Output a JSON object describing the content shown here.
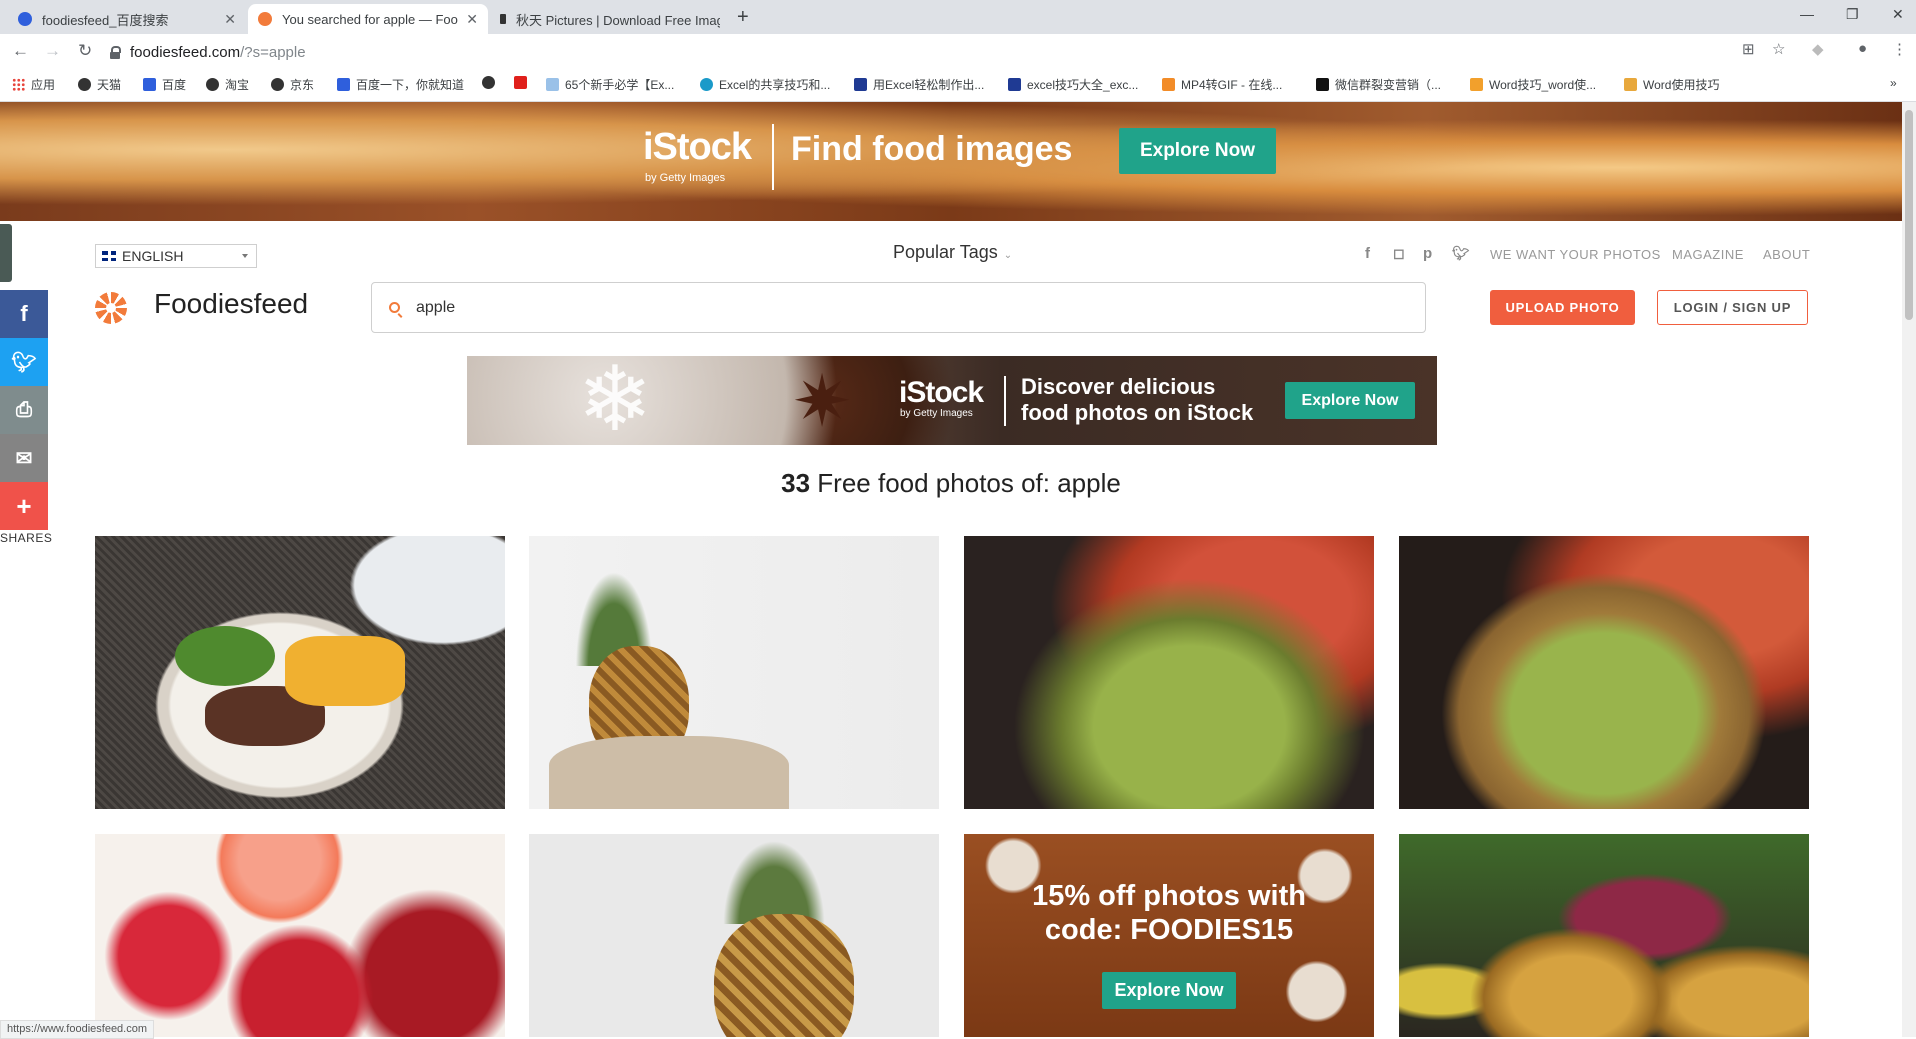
{
  "browser": {
    "tabs": [
      {
        "title": "foodiesfeed_百度搜索",
        "active": false
      },
      {
        "title": "You searched for apple — Foodiesfeed",
        "active": true
      },
      {
        "title": "秋天 Pictures | Download Free Images on Unsplash",
        "active": false
      }
    ],
    "url_domain": "foodiesfeed.com",
    "url_path": "/?s=apple",
    "bookmarks": [
      "应用",
      "天猫",
      "百度",
      "淘宝",
      "京东",
      "百度一下，你就知道",
      "",
      "",
      "65个新手必学【Ex...",
      "Excel的共享技巧和...",
      "用Excel轻松制作出...",
      "excel技巧大全_exc...",
      "MP4转GIF - 在线...",
      "微信群裂变营销（...",
      "Word技巧_word使...",
      "Word使用技巧"
    ],
    "status_url": "https://www.foodiesfeed.com"
  },
  "top_ad": {
    "logo": "iStock",
    "logo_sub": "by Getty Images",
    "headline": "Find food images",
    "cta": "Explore Now"
  },
  "header": {
    "language": "ENGLISH",
    "popular_tags": "Popular Tags",
    "nav": [
      "WE WANT YOUR PHOTOS",
      "MAGAZINE",
      "ABOUT"
    ],
    "brand": "Foodiesfeed",
    "search_value": "apple",
    "upload_label": "UPLOAD PHOTO",
    "login_label": "LOGIN / SIGN UP"
  },
  "mid_ad": {
    "logo": "iStock",
    "logo_sub": "by Getty Images",
    "headline_line1": "Discover delicious",
    "headline_line2": "food photos on iStock",
    "cta": "Explore Now"
  },
  "results": {
    "count": "33",
    "label": "Free food photos of: apple"
  },
  "promo": {
    "line1": "15% off photos with",
    "line2": "code: FOODIES15",
    "cta": "Explore Now"
  },
  "share": {
    "label": "SHARES",
    "items": [
      "facebook",
      "twitter",
      "print",
      "email",
      "more"
    ]
  },
  "colors": {
    "accent": "#f27b3b",
    "upload": "#f05e3e",
    "istock_green": "#20a38a",
    "facebook": "#3b5998",
    "twitter": "#1da1f2",
    "print": "#7f8c8d",
    "email": "#848484",
    "more": "#f0524a"
  }
}
